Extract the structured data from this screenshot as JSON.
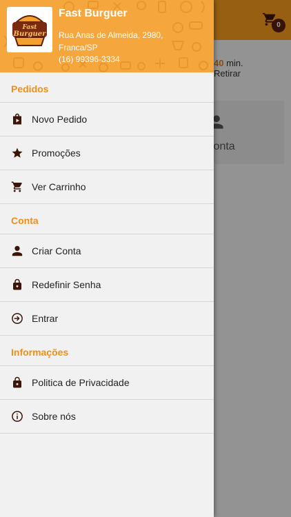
{
  "store": {
    "name": "Fast Burguer",
    "address": "Rua Anas de Almeida, 2980, Franca/SP",
    "phone": "(16) 99396-3334",
    "logo_text": "Fast Burguer"
  },
  "background_app": {
    "cart_count": "0",
    "time_value": "40",
    "time_unit": "min.",
    "pickup_label": "Retirar",
    "account_card_label": "Conta"
  },
  "menu": {
    "sections": [
      {
        "title": "Pedidos",
        "items": [
          {
            "label": "Novo Pedido",
            "icon": "shopping-bag-icon"
          },
          {
            "label": "Promoções",
            "icon": "star-icon"
          },
          {
            "label": "Ver Carrinho",
            "icon": "cart-icon"
          }
        ]
      },
      {
        "title": "Conta",
        "items": [
          {
            "label": "Criar Conta",
            "icon": "person-icon"
          },
          {
            "label": "Redefinir Senha",
            "icon": "lock-icon"
          },
          {
            "label": "Entrar",
            "icon": "sign-in-icon"
          }
        ]
      },
      {
        "title": "Informações",
        "items": [
          {
            "label": "Politica de Privacidade",
            "icon": "lock-icon"
          },
          {
            "label": "Sobre nós",
            "icon": "info-icon"
          }
        ]
      }
    ]
  },
  "colors": {
    "accent": "#ef8f16",
    "header_bg": "#f5a63c",
    "icon_dark": "#3b1508",
    "badge": "#5a1e0c"
  }
}
